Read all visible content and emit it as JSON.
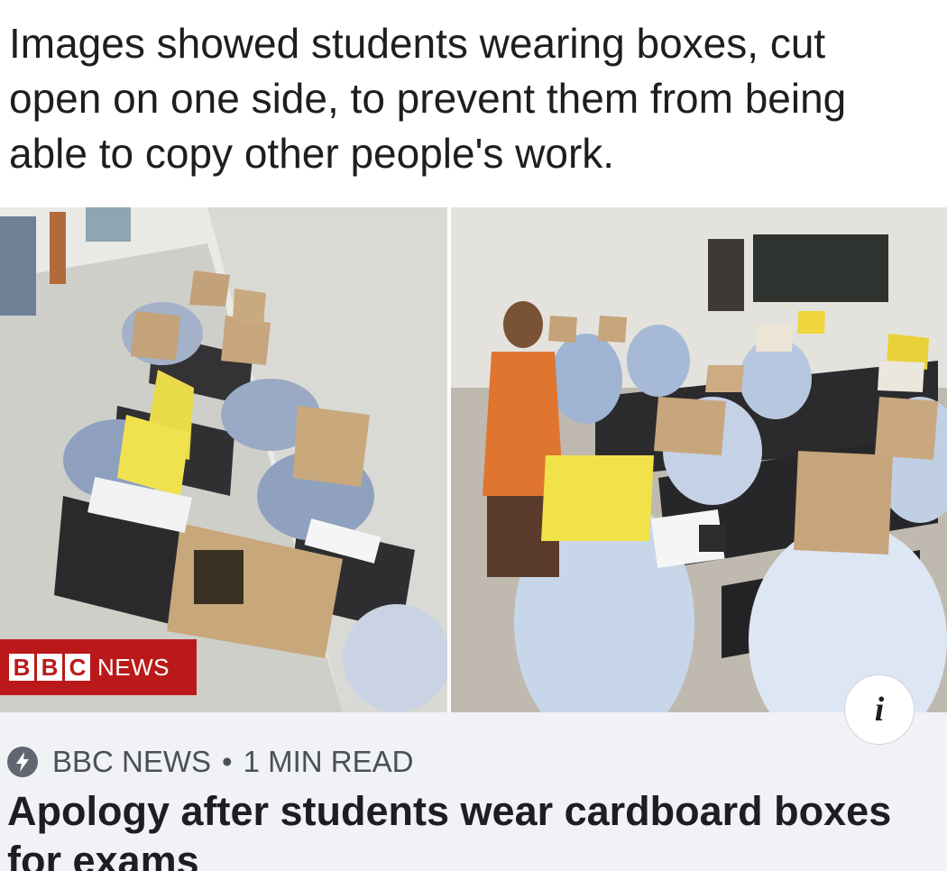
{
  "post": {
    "caption": "Images showed students wearing boxes, cut open on one side, to prevent them from being able to copy other people's work."
  },
  "image": {
    "watermark_text": "BBC NEWS",
    "watermark_blocks": [
      "B",
      "B",
      "C"
    ],
    "watermark_suffix": "NEWS",
    "info_glyph": "i",
    "info_icon": "info-icon"
  },
  "link_preview": {
    "source_icon": "bolt-icon",
    "source": "BBC NEWS",
    "separator": "•",
    "read_time": "1 MIN READ",
    "headline": "Apology after students wear cardboard boxes for exams"
  },
  "colors": {
    "bbc_red": "#bb1919",
    "preview_bg": "#f0f2f5",
    "text": "#1c1e21",
    "meta_text": "#4b4f56"
  }
}
